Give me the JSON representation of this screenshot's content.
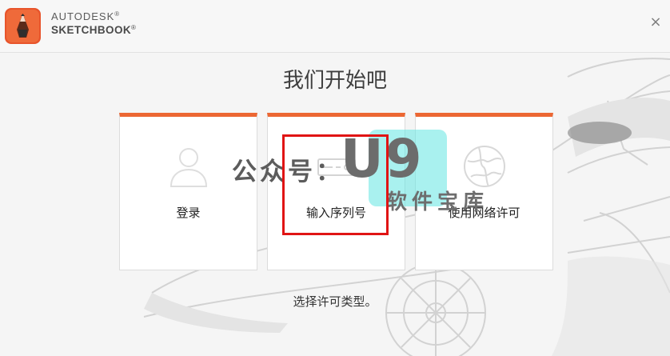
{
  "header": {
    "brand_line1": "AUTODESK",
    "brand_line1_mark": "®",
    "brand_line2": "SKETCHBOOK",
    "brand_line2_mark": "®",
    "close_label": "×"
  },
  "main": {
    "title": "我们开始吧",
    "footer_text": "选择许可类型。",
    "cards": [
      {
        "label": "登录",
        "icon": "user-icon"
      },
      {
        "label": "输入序列号",
        "icon": "serial-number-icon"
      },
      {
        "label": "使用网络许可",
        "icon": "network-globe-icon"
      }
    ]
  },
  "watermark": {
    "text1": "公众号：",
    "text2": "U9",
    "text3": "软件宝库"
  },
  "colors": {
    "accent": "#ec6733",
    "highlight_box": "#e01414",
    "watermark_teal": "#62e6e2"
  }
}
